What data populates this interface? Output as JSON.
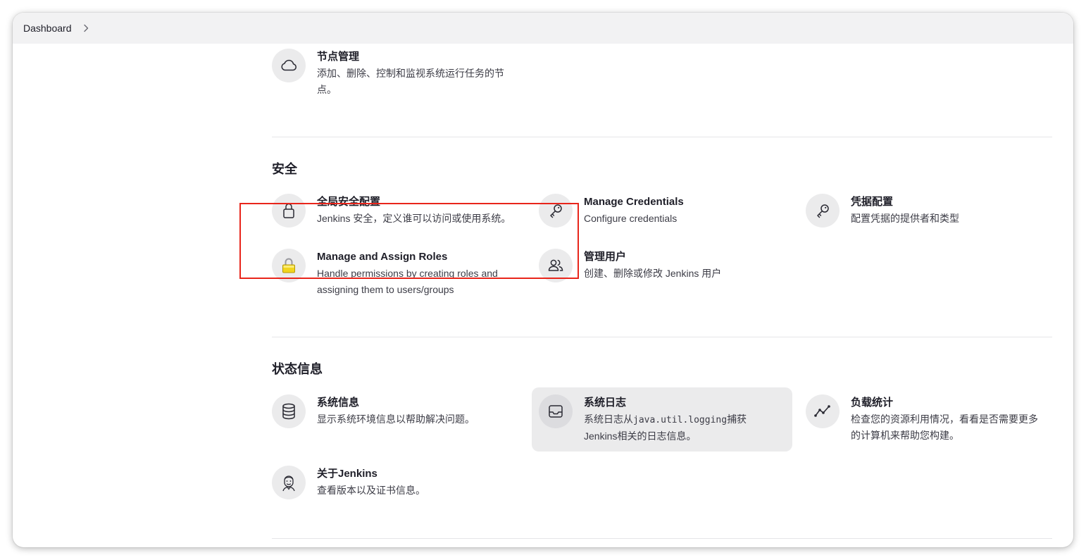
{
  "breadcrumb": {
    "label": "Dashboard"
  },
  "sections": {
    "top": {
      "items": [
        {
          "title": "节点管理",
          "desc_line1": "添加、删除、控制和监视系统运行任务的节",
          "desc_line2": "点。",
          "icon": "cloud-icon"
        }
      ]
    },
    "security": {
      "title": "安全",
      "items": [
        {
          "title": "全局安全配置",
          "desc": "Jenkins 安全，定义谁可以访问或使用系统。",
          "icon": "lock-icon"
        },
        {
          "title": "Manage Credentials",
          "desc": "Configure credentials",
          "icon": "key-icon"
        },
        {
          "title": "凭据配置",
          "desc": "配置凭据的提供者和类型",
          "icon": "key-icon"
        },
        {
          "title": "Manage and Assign Roles",
          "desc_line1": "Handle permissions by creating roles and",
          "desc_line2": "assigning them to users/groups",
          "icon": "padlock-yellow-icon"
        },
        {
          "title": "管理用户",
          "desc": "创建、删除或修改 Jenkins 用户",
          "icon": "users-icon"
        }
      ]
    },
    "status": {
      "title": "状态信息",
      "items": [
        {
          "title": "系统信息",
          "desc": "显示系统环境信息以帮助解决问题。",
          "icon": "database-icon"
        },
        {
          "title": "系统日志",
          "desc_pre": "系统日志从",
          "desc_code": "java.util.logging",
          "desc_post": "捕获",
          "desc_line2": "Jenkins相关的日志信息。",
          "icon": "inbox-icon"
        },
        {
          "title": "负载统计",
          "desc_line1": "检查您的资源利用情况，看看是否需要更多",
          "desc_line2": "的计算机来帮助您构建。",
          "icon": "line-chart-icon"
        },
        {
          "title": "关于Jenkins",
          "desc": "查看版本以及证书信息。",
          "icon": "jenkins-butler-icon"
        }
      ]
    }
  },
  "colors": {
    "highlight": "#e8251b",
    "icon_bg": "#ebebec",
    "hover_bg": "#ebebec",
    "text": "#1e1e28"
  }
}
